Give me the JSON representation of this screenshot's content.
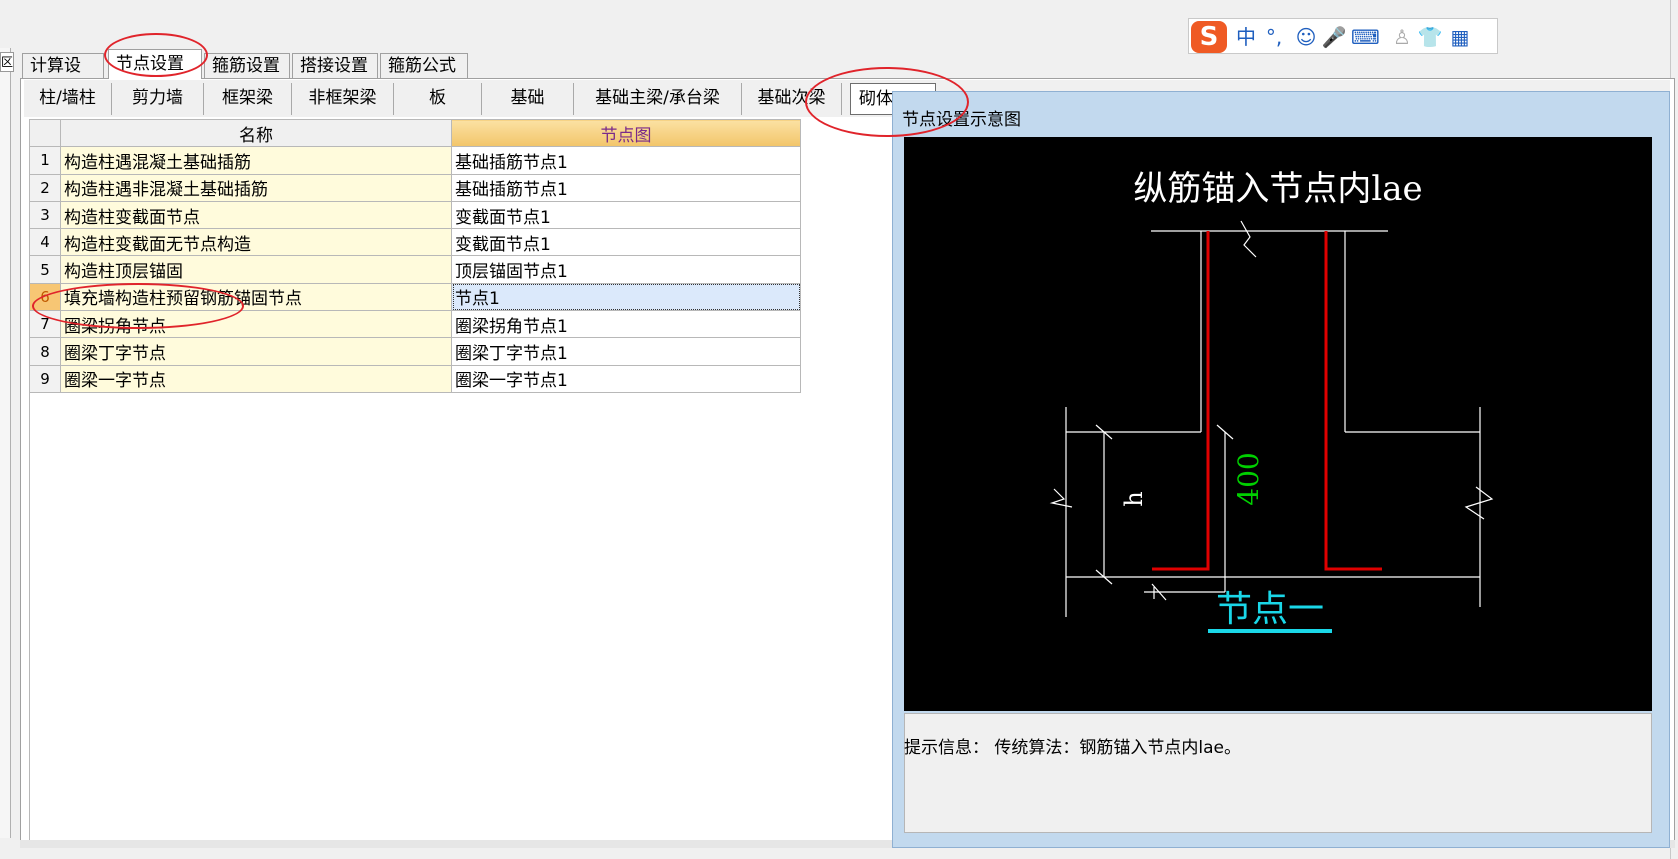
{
  "ime": {
    "logo": "S",
    "items": [
      "中",
      "°,",
      "☺",
      "🎤",
      "⌨",
      "♙",
      "👕",
      "▦"
    ]
  },
  "left_panel": {
    "close_glyph": "区"
  },
  "main_tabs": [
    {
      "label": "计算设置"
    },
    {
      "label": "节点设置"
    },
    {
      "label": "箍筋设置"
    },
    {
      "label": "搭接设置"
    },
    {
      "label": "箍筋公式"
    }
  ],
  "sub_tabs": [
    {
      "label": "柱/墙柱"
    },
    {
      "label": "剪力墙"
    },
    {
      "label": "框架梁"
    },
    {
      "label": "非框架梁"
    },
    {
      "label": "板"
    },
    {
      "label": "基础"
    },
    {
      "label": "基础主梁/承台梁"
    },
    {
      "label": "基础次梁"
    },
    {
      "label": "砌体"
    }
  ],
  "grid": {
    "headers": {
      "name": "名称",
      "node": "节点图"
    },
    "rows": [
      {
        "n": "1",
        "name": "构造柱遇混凝土基础插筋",
        "node": "基础插筋节点1"
      },
      {
        "n": "2",
        "name": "构造柱遇非混凝土基础插筋",
        "node": "基础插筋节点1"
      },
      {
        "n": "3",
        "name": "构造柱变截面节点",
        "node": "变截面节点1"
      },
      {
        "n": "4",
        "name": "构造柱变截面无节点构造",
        "node": "变截面节点1"
      },
      {
        "n": "5",
        "name": "构造柱顶层锚固",
        "node": "顶层锚固节点1"
      },
      {
        "n": "6",
        "name": "填充墙构造柱预留钢筋锚固节点",
        "node": "节点1"
      },
      {
        "n": "7",
        "name": "圈梁拐角节点",
        "node": "圈梁拐角节点1"
      },
      {
        "n": "8",
        "name": "圈梁丁字节点",
        "node": "圈梁丁字节点1"
      },
      {
        "n": "9",
        "name": "圈梁一字节点",
        "node": "圈梁一字节点1"
      }
    ]
  },
  "dialog": {
    "title": "节点设置示意图",
    "diagram": {
      "heading": "纵筋锚入节点内lae",
      "dim_h": "h",
      "dim_400": "400",
      "caption": "节点一"
    },
    "info": "提示信息： 传统算法：钢筋锚入节点内lae。"
  },
  "colors": {
    "rebar": "#e00000",
    "dimension_green": "#00d000",
    "caption_cyan": "#1ad7e8",
    "annotation_red": "#e0242b",
    "selected_row": "#dbe9fb"
  }
}
